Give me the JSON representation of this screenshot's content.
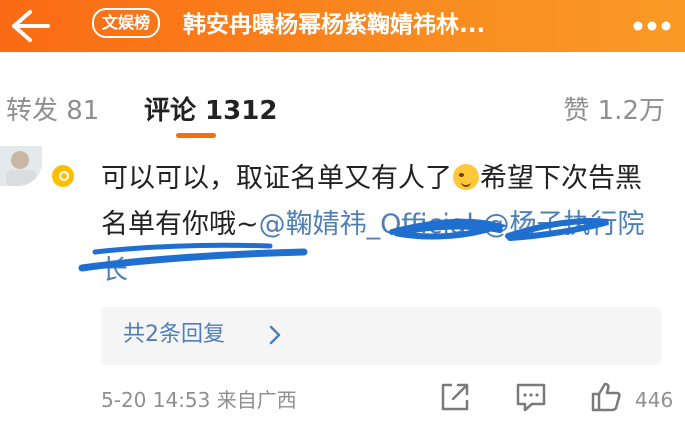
{
  "header": {
    "badge_label": "文娱榜",
    "title": "韩安冉曝杨幂杨紫鞠婧祎林...",
    "back_icon": "back-arrow-icon",
    "more_icon": "more-dots-icon",
    "background_color": "#fa7c1a"
  },
  "tabs": {
    "repost": "转发 81",
    "comment": "评论 1312",
    "like": "赞 1.2万",
    "active_color": "#f46f10"
  },
  "comment": {
    "text_part1": "可以可以，取证名单又有人了",
    "emoji": "smirk-emoji",
    "text_part2": "希望下次告黑名单有你哦~",
    "mention_1": "@鞠婧祎_Official",
    "mention_2": "@杨子执行院长",
    "verified_icon": "verified-badge-icon",
    "mention_color": "#4f7fb6"
  },
  "replies": {
    "label": "共2条回复",
    "chevron_icon": "chevron-right-icon"
  },
  "meta": {
    "date_source": "5-20 14:53  来自广西",
    "like_count": "446",
    "share_icon": "share-icon",
    "comment_icon": "comment-icon",
    "like_icon": "thumbs-up-icon"
  }
}
